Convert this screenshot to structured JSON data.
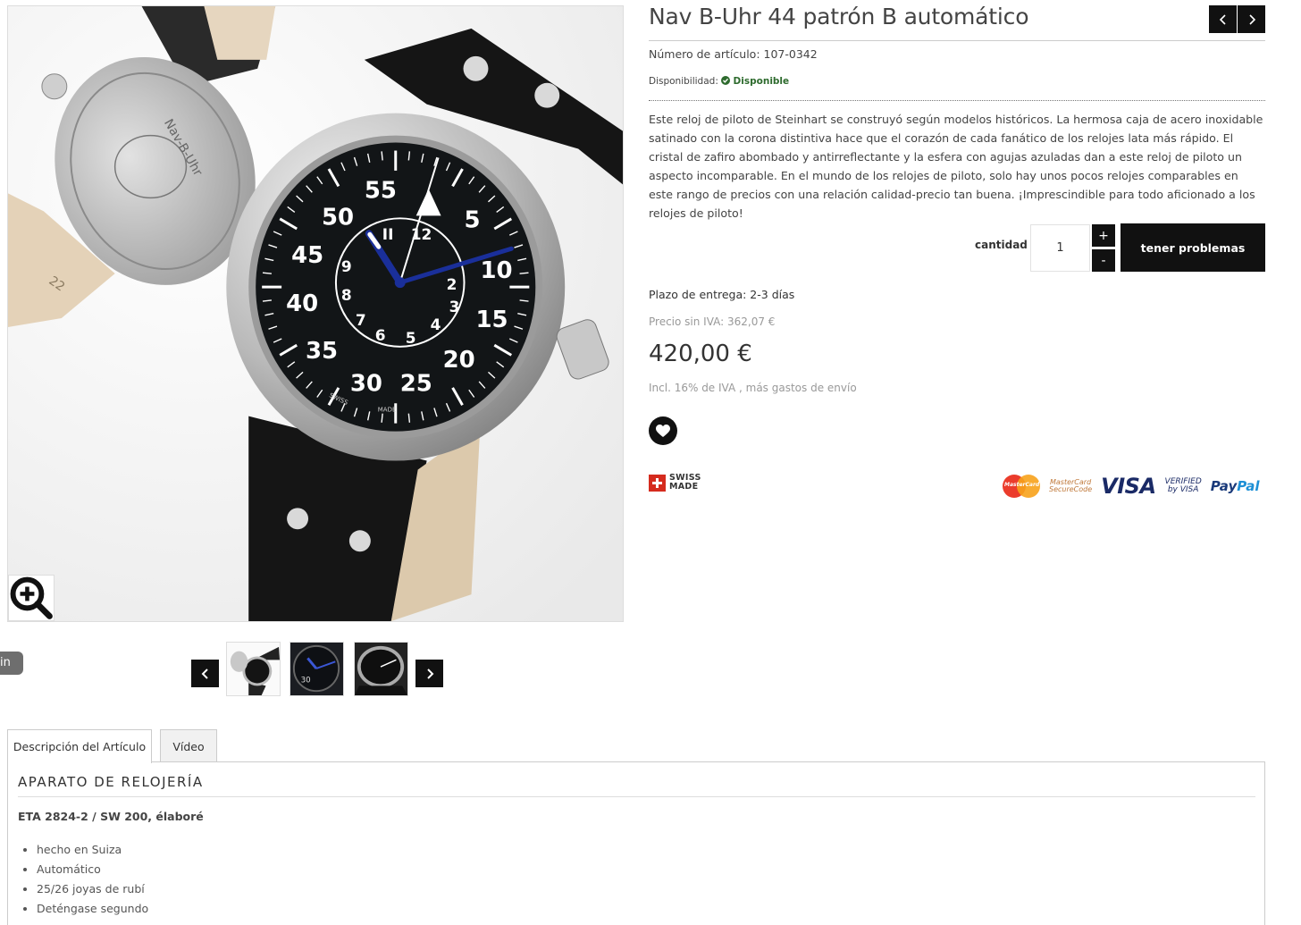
{
  "product": {
    "title": "Nav B-Uhr 44 patrón B automático",
    "article_number": "Número de artículo: 107-0342",
    "availability_label": "Disponibilidad:",
    "availability_value": "Disponible",
    "description": "Este reloj de piloto de Steinhart se construyó según modelos históricos. La hermosa caja de acero inoxidable satinado con la corona distintiva hace que el corazón de cada fanático de los relojes lata más rápido. El cristal de zafiro abombado y antirreflectante y la esfera con agujas azuladas dan a este reloj de piloto un aspecto incomparable. En el mundo de los relojes de piloto, solo hay unos pocos relojes comparables en este rango de precios con una relación calidad-precio tan buena. ¡Imprescindible para todo aficionado a los relojes de piloto!",
    "quantity_label": "cantidad",
    "quantity_value": "1",
    "plus_label": "+",
    "minus_label": "-",
    "cart_button": "tener problemas",
    "delivery": "Plazo de entrega: 2-3 días",
    "net_price": "Precio sin IVA: 362,07 €",
    "price": "420,00 €",
    "vat_note": "Incl. 16% de IVA , más gastos de envío",
    "swiss_line1": "SWISS",
    "swiss_line2": "MADE"
  },
  "payments": {
    "mastercard": "MasterCard",
    "securecode_line1": "MasterCard",
    "securecode_line2": "SecureCode",
    "visa": "VISA",
    "vbv_line1": "VERIFIED",
    "vbv_line2": "by VISA",
    "paypal_a": "Pay",
    "paypal_b": "Pal"
  },
  "gallery": {
    "side_tab": "in",
    "dial_numbers": [
      "55",
      "5",
      "10",
      "15",
      "20",
      "25",
      "30",
      "35",
      "40",
      "45",
      "50"
    ],
    "inner_numbers": [
      "12",
      "2",
      "3",
      "4",
      "5",
      "6",
      "7",
      "8",
      "9"
    ],
    "inner_eleven": "II",
    "dial_swiss": "SWISS",
    "dial_made": "MADE",
    "caseback_text": "Nav-B-Uhr",
    "strap_number": "22"
  },
  "tabs": [
    {
      "label": "Descripción del Artículo"
    },
    {
      "label": "Vídeo"
    }
  ],
  "details": {
    "section_title": "APARATO DE RELOJERÍA",
    "movement": "ETA 2824-2 / SW 200, élaboré",
    "features": [
      "hecho en Suiza",
      "Automático",
      "25/26 joyas de rubí",
      "Deténgase segundo"
    ]
  },
  "colors": {
    "button_bg": "#111111",
    "availability_ok": "#2e6b2e",
    "swiss_red": "#d52b1e"
  },
  "icons": {
    "zoom": "magnifier-plus-icon",
    "prev": "chevron-left-icon",
    "next": "chevron-right-icon",
    "wishlist": "heart-icon",
    "available": "check-circle-icon"
  }
}
